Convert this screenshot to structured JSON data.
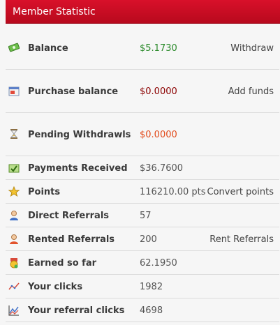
{
  "panel": {
    "title": "Member Statistic"
  },
  "rows": [
    {
      "label": "Balance",
      "value": "$5.1730",
      "action": "Withdraw"
    },
    {
      "label": "Purchase balance",
      "value": "$0.0000",
      "action": "Add funds"
    },
    {
      "label": "Pending Withdrawls",
      "value": "$0.0000",
      "action": ""
    },
    {
      "label": "Payments Received",
      "value": "$36.7600",
      "action": ""
    },
    {
      "label": "Points",
      "value": "116210.00 pts",
      "action": "Convert points"
    },
    {
      "label": "Direct Referrals",
      "value": "57",
      "action": ""
    },
    {
      "label": "Rented Referrals",
      "value": "200",
      "action": "Rent Referrals"
    },
    {
      "label": "Earned so far",
      "value": "62.1950",
      "action": ""
    },
    {
      "label": "Your clicks",
      "value": "1982",
      "action": ""
    },
    {
      "label": "Your referral clicks",
      "value": "4698",
      "action": ""
    }
  ],
  "colors": {
    "header_red": "#c80d22",
    "value_green": "#2a8a2a",
    "value_dark_red": "#8b0000",
    "value_orange": "#e24a1a"
  },
  "icons": [
    "money-icon",
    "purchase-balance-icon",
    "hourglass-icon",
    "payment-received-icon",
    "star-medal-icon",
    "user-icon",
    "user-rented-icon",
    "medal-icon",
    "clicks-chart-icon",
    "referral-clicks-chart-icon"
  ]
}
